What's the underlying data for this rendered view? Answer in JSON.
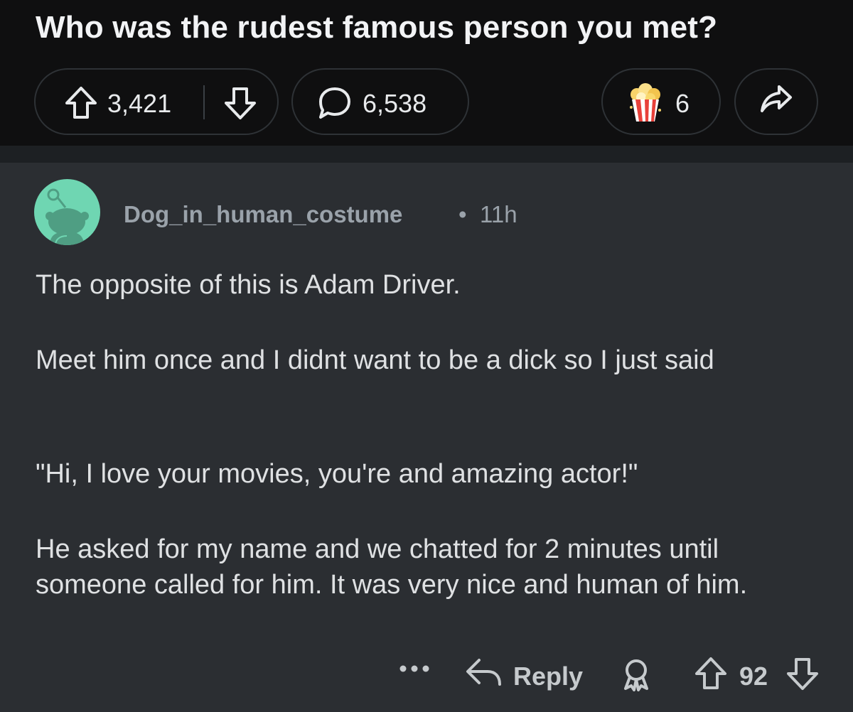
{
  "post": {
    "title": "Who was the rudest famous person you met?",
    "upvotes": "3,421",
    "comments": "6,538",
    "awards": "6"
  },
  "comment": {
    "author": "Dog_in_human_costume",
    "separator": "•",
    "time": "11h",
    "paragraphs": [
      "The opposite of this is Adam Driver.",
      "Meet him once and I didnt want to be a dick so I just said",
      "\"Hi, I love your movies, you're and amazing actor!\"",
      "He asked for my name and we chatted for 2 minutes until someone called for him. It was very nice and human of him."
    ],
    "more_label": "•••",
    "reply_label": "Reply",
    "score": "92"
  },
  "colors": {
    "header_bg": "#0f0f10",
    "comment_bg": "#2b2e32",
    "avatar_bg": "#6fd6b2",
    "text": "#dfe1e3",
    "meta": "#9aa2aa"
  },
  "icons": {
    "upvote": "arrow-up-outline-icon",
    "downvote": "arrow-down-outline-icon",
    "comment": "speech-bubble-icon",
    "award": "popcorn-award-icon",
    "share": "share-arrow-icon",
    "reply": "reply-arrow-icon",
    "give_award": "award-ribbon-icon",
    "more": "more-dots-icon"
  }
}
